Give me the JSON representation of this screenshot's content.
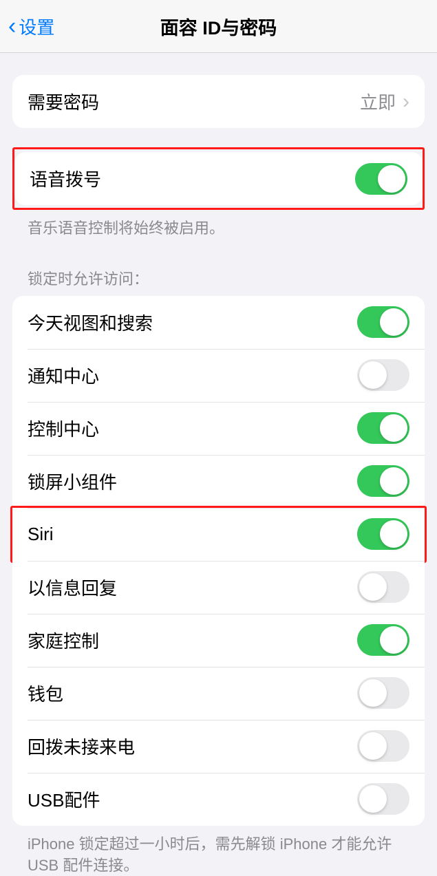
{
  "header": {
    "back_label": "设置",
    "title": "面容 ID与密码"
  },
  "passcode_row": {
    "label": "需要密码",
    "value": "立即"
  },
  "voice_dial": {
    "label": "语音拨号",
    "footer": "音乐语音控制将始终被启用。"
  },
  "lock_access": {
    "header": "锁定时允许访问：",
    "items": [
      {
        "label": "今天视图和搜索",
        "on": true
      },
      {
        "label": "通知中心",
        "on": false
      },
      {
        "label": "控制中心",
        "on": true
      },
      {
        "label": "锁屏小组件",
        "on": true
      },
      {
        "label": "Siri",
        "on": true
      },
      {
        "label": "以信息回复",
        "on": false
      },
      {
        "label": "家庭控制",
        "on": true
      },
      {
        "label": "钱包",
        "on": false
      },
      {
        "label": "回拨未接来电",
        "on": false
      },
      {
        "label": "USB配件",
        "on": false
      }
    ],
    "footer": "iPhone 锁定超过一小时后，需先解锁 iPhone 才能允许USB 配件连接。"
  },
  "highlights": {
    "voice_dial_group": true,
    "siri_row_index": 4
  }
}
